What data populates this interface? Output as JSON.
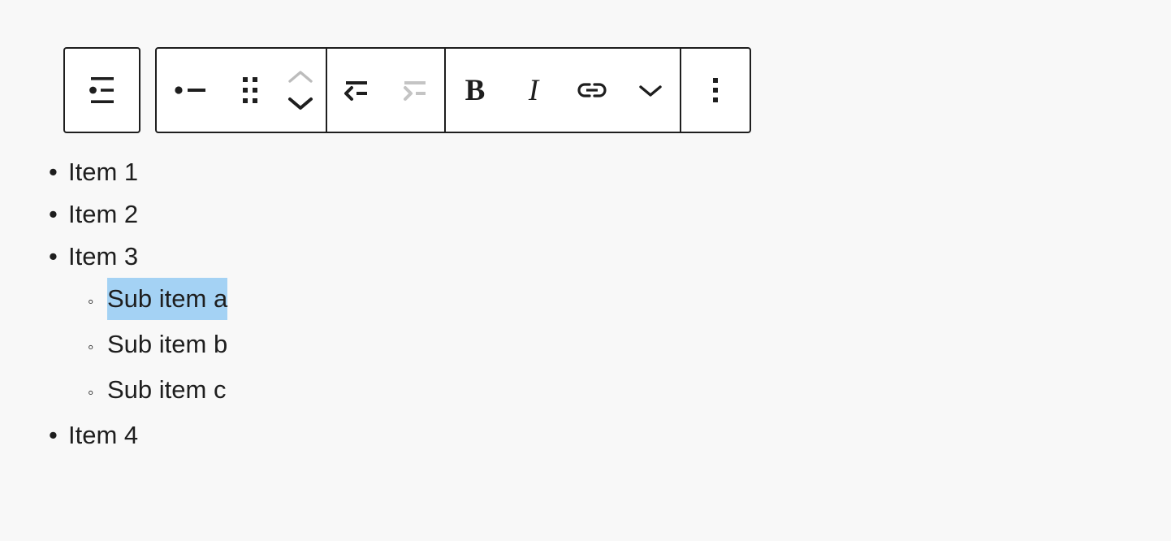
{
  "colors": {
    "page_background": "#f8f8f8",
    "toolbar_background": "#ffffff",
    "toolbar_border": "#1e1e1e",
    "text": "#1e1e1e",
    "disabled_icon": "#bcbcbc",
    "selection_highlight": "#a4d2f4"
  },
  "toolbar": {
    "block_type_button": {
      "icon": "list-view-icon",
      "label": "List",
      "enabled": true
    },
    "groups": [
      {
        "name": "block-controls",
        "buttons": [
          {
            "icon": "bullet-list-icon",
            "label": "Change block type or style",
            "enabled": true
          },
          {
            "icon": "drag-handle-icon",
            "label": "Drag",
            "enabled": true
          },
          {
            "icon": "chevron-up-icon",
            "label": "Move up",
            "enabled": false
          },
          {
            "icon": "chevron-down-icon",
            "label": "Move down",
            "enabled": true
          }
        ]
      },
      {
        "name": "indentation-controls",
        "buttons": [
          {
            "icon": "outdent-icon",
            "label": "Outdent",
            "enabled": true
          },
          {
            "icon": "indent-icon",
            "label": "Indent",
            "enabled": false
          }
        ]
      },
      {
        "name": "text-formatting",
        "buttons": [
          {
            "icon": "bold-icon",
            "label": "Bold",
            "glyph": "B",
            "enabled": true
          },
          {
            "icon": "italic-icon",
            "label": "Italic",
            "glyph": "I",
            "enabled": true
          },
          {
            "icon": "link-icon",
            "label": "Link",
            "enabled": true
          },
          {
            "icon": "chevron-down-icon",
            "label": "More rich text controls",
            "enabled": true
          }
        ]
      },
      {
        "name": "block-options",
        "buttons": [
          {
            "icon": "more-vertical-icon",
            "label": "Options",
            "enabled": true
          }
        ]
      }
    ]
  },
  "list": {
    "items": [
      {
        "text": "Item 1",
        "level": 1,
        "marker": "disc",
        "selected": false
      },
      {
        "text": "Item 2",
        "level": 1,
        "marker": "disc",
        "selected": false
      },
      {
        "text": "Item 3",
        "level": 1,
        "marker": "disc",
        "selected": false
      },
      {
        "text": "Sub item a",
        "level": 2,
        "marker": "circle",
        "selected": true
      },
      {
        "text": "Sub item b",
        "level": 2,
        "marker": "circle",
        "selected": false
      },
      {
        "text": "Sub item c",
        "level": 2,
        "marker": "circle",
        "selected": false
      },
      {
        "text": "Item 4",
        "level": 1,
        "marker": "disc",
        "selected": false
      }
    ],
    "markers": {
      "disc": "•",
      "circle": "◦"
    }
  }
}
